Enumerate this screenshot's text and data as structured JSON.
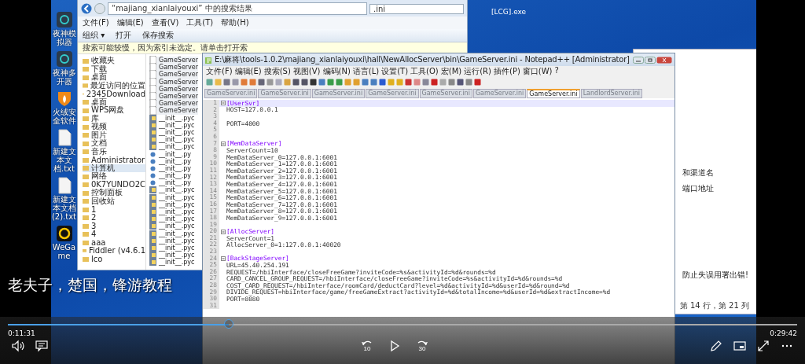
{
  "desktop": {
    "icons": [
      {
        "label": "夜神模拟器",
        "kind": "nox"
      },
      {
        "label": "夜神多开器",
        "kind": "nox"
      },
      {
        "label": "火绒安全软件",
        "kind": "shield"
      },
      {
        "label": "新建文本文档.txt",
        "kind": "doc"
      },
      {
        "label": "新建文本文档(2).txt",
        "kind": "doc"
      },
      {
        "label": "WeGame",
        "kind": "wegame"
      }
    ],
    "top_labels": [
      "[LCG].exe"
    ]
  },
  "explorer": {
    "address": "“majiang_xianlaiyouxi” 中的搜索结果",
    "search": ".ini",
    "menu": [
      "文件(F)",
      "编辑(E)",
      "查看(V)",
      "工具(T)",
      "帮助(H)"
    ],
    "toolbar": [
      "组织 ▾",
      "打开",
      "保存搜索"
    ],
    "info_bar": "搜索可能较慢，因为索引未选定。请单击打开索",
    "sidebar": [
      {
        "label": "收藏夹",
        "selected": false
      },
      {
        "label": "下载",
        "selected": false
      },
      {
        "label": "桌面",
        "selected": false
      },
      {
        "label": "最近访问的位置",
        "selected": false
      },
      {
        "label": "2345Download",
        "selected": false
      },
      {
        "label": "桌面",
        "selected": false
      },
      {
        "label": "WPS网盘",
        "selected": false
      },
      {
        "label": "库",
        "selected": false
      },
      {
        "label": "视频",
        "selected": false
      },
      {
        "label": "图片",
        "selected": false
      },
      {
        "label": "文档",
        "selected": false
      },
      {
        "label": "音乐",
        "selected": false
      },
      {
        "label": "Administrator",
        "selected": false
      },
      {
        "label": "计算机",
        "selected": true
      },
      {
        "label": "网络",
        "selected": false
      },
      {
        "label": "0K7YUNDO2C",
        "selected": false
      },
      {
        "label": "控制面板",
        "selected": false
      },
      {
        "label": "回收站",
        "selected": false
      },
      {
        "label": "1",
        "selected": false
      },
      {
        "label": "2",
        "selected": false
      },
      {
        "label": "3",
        "selected": false
      },
      {
        "label": "4",
        "selected": false
      },
      {
        "label": "aaa",
        "selected": false
      },
      {
        "label": "Fiddler (v4.6.1",
        "selected": false
      },
      {
        "label": "lco",
        "selected": false
      }
    ],
    "files": [
      {
        "name": "GameServer",
        "kind": "ini"
      },
      {
        "name": "GameServer",
        "kind": "ini"
      },
      {
        "name": "GameServer",
        "kind": "ini"
      },
      {
        "name": "GameServer",
        "kind": "ini"
      },
      {
        "name": "GameServer",
        "kind": "ini"
      },
      {
        "name": "GameServer",
        "kind": "ini"
      },
      {
        "name": "GameServer",
        "kind": "ini"
      },
      {
        "name": "GameServer",
        "kind": "ini"
      },
      {
        "name": "__init__.pyc",
        "kind": "pyc"
      },
      {
        "name": "__init__.pyc",
        "kind": "pyc"
      },
      {
        "name": "__init__.pyc",
        "kind": "pyc"
      },
      {
        "name": "__init__.pyc",
        "kind": "pyc"
      },
      {
        "name": "__init__.pyc",
        "kind": "pyc"
      },
      {
        "name": "__init__.py",
        "kind": "py"
      },
      {
        "name": "__init__.py",
        "kind": "py"
      },
      {
        "name": "__init__.py",
        "kind": "py"
      },
      {
        "name": "__init__.py",
        "kind": "py"
      },
      {
        "name": "__init__.py",
        "kind": "py"
      },
      {
        "name": "__init__.pyc",
        "kind": "pyc"
      },
      {
        "name": "__init__.pyc",
        "kind": "pyc"
      },
      {
        "name": "__init__.pyc",
        "kind": "pyc"
      },
      {
        "name": "__init__.pyc",
        "kind": "pyc"
      },
      {
        "name": "__init__.pyc",
        "kind": "pyc"
      },
      {
        "name": "__init__.pyc",
        "kind": "pyc"
      },
      {
        "name": "__init__.pyc",
        "kind": "pyc"
      },
      {
        "name": "__init__.pyc",
        "kind": "pyc"
      },
      {
        "name": "__init__.pyc",
        "kind": "pyc"
      },
      {
        "name": "__init__.pyc",
        "kind": "pyc"
      },
      {
        "name": "__init__.pyc",
        "kind": "pyc"
      }
    ]
  },
  "notepad": {
    "title": "E:\\麻将\\tools-1.0.2\\majiang_xianlaiyouxi\\hall\\NewAllocServer\\bin\\GameServer.ini - Notepad++ [Administrator]",
    "menu": [
      "文件(F)",
      "编辑(E)",
      "搜索(S)",
      "视图(V)",
      "编码(N)",
      "语言(L)",
      "设置(T)",
      "工具(O)",
      "宏(M)",
      "运行(R)",
      "插件(P)",
      "窗口(W)",
      "?"
    ],
    "tabs": [
      {
        "label": "GameServer.ini",
        "selected": false
      },
      {
        "label": "GameServer.ini",
        "selected": false
      },
      {
        "label": "GameServer.ini",
        "selected": false
      },
      {
        "label": "GameServer.ini",
        "selected": false
      },
      {
        "label": "GameServer.ini",
        "selected": false
      },
      {
        "label": "GameServer.ini",
        "selected": false
      },
      {
        "label": "GameServer.ini",
        "selected": true
      },
      {
        "label": "LandlordServer.ini",
        "selected": false
      }
    ],
    "lines": [
      {
        "number": "1",
        "kind": "section",
        "text": "[UserSvr]"
      },
      {
        "number": "2",
        "kind": "pair",
        "text": "HOST=127.0.0.1"
      },
      {
        "number": "3",
        "kind": "blank"
      },
      {
        "number": "4",
        "kind": "pair",
        "text": "PORT=4000"
      },
      {
        "number": "5",
        "kind": "blank"
      },
      {
        "number": "6",
        "kind": "blank"
      },
      {
        "number": "7",
        "kind": "section",
        "text": "[MemDataServer]"
      },
      {
        "number": "8",
        "kind": "pair",
        "text": "ServerCount=10"
      },
      {
        "number": "9",
        "kind": "pair",
        "text": "MemDataServer_0=127.0.0.1:6001"
      },
      {
        "number": "10",
        "kind": "pair",
        "text": "MemDataServer_1=127.0.0.1:6001"
      },
      {
        "number": "11",
        "kind": "pair",
        "text": "MemDataServer_2=127.0.0.1:6001"
      },
      {
        "number": "12",
        "kind": "pair",
        "text": "MemDataServer_3=127.0.0.1:6001"
      },
      {
        "number": "13",
        "kind": "pair",
        "text": "MemDataServer_4=127.0.0.1:6001"
      },
      {
        "number": "14",
        "kind": "pair",
        "text": "MemDataServer_5=127.0.0.1:6001"
      },
      {
        "number": "15",
        "kind": "pair",
        "text": "MemDataServer_6=127.0.0.1:6001"
      },
      {
        "number": "16",
        "kind": "pair",
        "text": "MemDataServer_7=127.0.0.1:6001"
      },
      {
        "number": "17",
        "kind": "pair",
        "text": "MemDataServer_8=127.0.0.1:6001"
      },
      {
        "number": "18",
        "kind": "pair",
        "text": "MemDataServer_9=127.0.0.1:6001"
      },
      {
        "number": "19",
        "kind": "blank"
      },
      {
        "number": "20",
        "kind": "section",
        "text": "[AllocServer]"
      },
      {
        "number": "21",
        "kind": "pair",
        "text": "ServerCount=1"
      },
      {
        "number": "22",
        "kind": "pair",
        "text": "AllocServer_0=1:127.0.0.1:40020"
      },
      {
        "number": "23",
        "kind": "blank"
      },
      {
        "number": "24",
        "kind": "section",
        "text": "[BackStageServer]"
      },
      {
        "number": "25",
        "kind": "pair",
        "text": "URL=45.40.254.191"
      },
      {
        "number": "26",
        "kind": "pair",
        "text": "REQUEST=/hbiInterface/closeFreeGame?inviteCode=%s&activityId=%d&rounds=%d"
      },
      {
        "number": "27",
        "kind": "pair",
        "text": "CARD_CANCEL_GROUP_REQUEST=/hbiInterface/closeFreeGame?inviteCode=%s&activityId=%d&rounds=%d"
      },
      {
        "number": "28",
        "kind": "pair",
        "text": "COST_CARD_REQUEST=/hbiInterface/roomCard/deductCard?level=%d&activityId=%d&userId=%d&round=%d"
      },
      {
        "number": "29",
        "kind": "pair",
        "text": "DIVIDE_REQUEST=hbiInterface/game/freeGameExtract?activityId=%d&totalIncome=%d&userId=%d&extractIncome=%d"
      },
      {
        "number": "30",
        "kind": "pair",
        "text": "PORT=8080"
      },
      {
        "number": "31",
        "kind": "blank"
      }
    ]
  },
  "back_window": {
    "texts": [
      "和渠道名",
      "端口地址",
      "防止失误用署出错!"
    ],
    "status": "第 14 行，第 21 列"
  },
  "player": {
    "subtitle": "老夫子，楚国，锋游教程",
    "elapsed": "0:11:31",
    "total": "0:29:42",
    "level": 0.28,
    "skip_back": "10",
    "skip_forward": "30"
  }
}
